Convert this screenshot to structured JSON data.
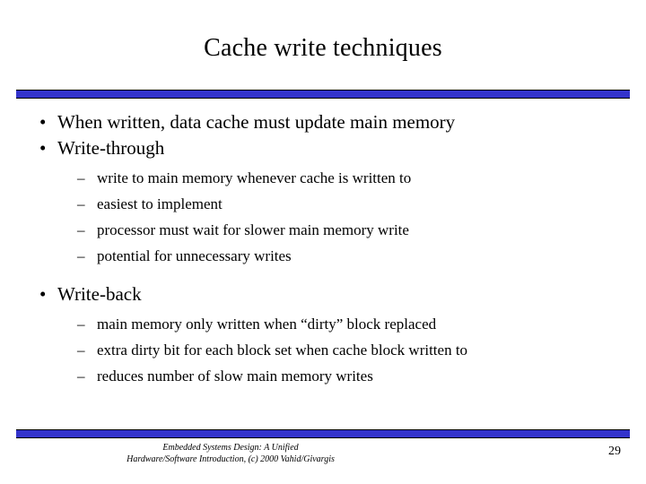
{
  "slide": {
    "title": "Cache write techniques",
    "bullet_glyph": "•",
    "dash_glyph": "–",
    "accent_color": "#3333cc",
    "sections": [
      {
        "text": "When written, data cache must update main memory",
        "subitems": []
      },
      {
        "text": "Write-through",
        "subitems": [
          "write to main memory whenever cache is written to",
          "easiest to implement",
          "processor must wait for slower main memory write",
          "potential for unnecessary writes"
        ]
      },
      {
        "text": "Write-back",
        "subitems": [
          "main memory only written when “dirty” block replaced",
          "extra dirty bit for each block set when cache block written to",
          "reduces number of slow main memory writes"
        ]
      }
    ],
    "footer_line1": "Embedded Systems Design: A Unified",
    "footer_line2": "Hardware/Software Introduction, (c) 2000 Vahid/Givargis",
    "page_number": "29"
  }
}
